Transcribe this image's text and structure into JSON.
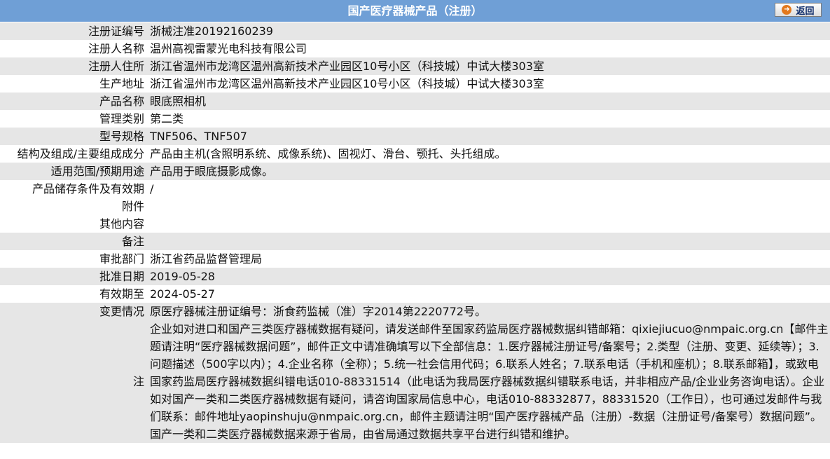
{
  "header": {
    "title": "国产医疗器械产品（注册）",
    "back_label": "返回"
  },
  "rows": [
    {
      "label": "注册证编号",
      "value": "浙械注准20192160239"
    },
    {
      "label": "注册人名称",
      "value": "温州高视雷蒙光电科技有限公司"
    },
    {
      "label": "注册人住所",
      "value": "浙江省温州市龙湾区温州高新技术产业园区10号小区（科技城）中试大楼303室"
    },
    {
      "label": "生产地址",
      "value": "浙江省温州市龙湾区温州高新技术产业园区10号小区（科技城）中试大楼303室"
    },
    {
      "label": "产品名称",
      "value": "眼底照相机"
    },
    {
      "label": "管理类别",
      "value": "第二类"
    },
    {
      "label": "型号规格",
      "value": "TNF506、TNF507"
    },
    {
      "label": "结构及组成/主要组成成分",
      "value": "产品由主机(含照明系统、成像系统)、固视灯、滑台、颚托、头托组成。"
    },
    {
      "label": "适用范围/预期用途",
      "value": "产品用于眼底摄影成像。"
    },
    {
      "label": "产品储存条件及有效期",
      "value": "/"
    },
    {
      "label": "附件",
      "value": ""
    },
    {
      "label": "其他内容",
      "value": ""
    },
    {
      "label": "备注",
      "value": ""
    },
    {
      "label": "审批部门",
      "value": "浙江省药品监督管理局"
    },
    {
      "label": "批准日期",
      "value": "2019-05-28"
    },
    {
      "label": "有效期至",
      "value": "2024-05-27"
    },
    {
      "label": "变更情况",
      "value": "原医疗器械注册证编号：浙食药监械（准）字2014第2220772号。"
    }
  ],
  "note": {
    "label": "注",
    "text": "企业如对进口和国产三类医疗器械数据有疑问，请发送邮件至国家药监局医疗器械数据纠错邮箱：qixiejiucuo@nmpaic.org.cn【邮件主题请注明“医疗器械数据问题”，邮件正文中请准确填写以下全部信息：1.医疗器械注册证号/备案号；2.类型（注册、变更、延续等）；3.问题描述（500字以内）；4.企业名称（全称）；5.统一社会信用代码；6.联系人姓名；7.联系电话（手机和座机）；8.联系邮箱】，或致电国家药监局医疗器械数据纠错电话010-88331514（此电话为我局医疗器械数据纠错联系电话，并非相应产品/企业业务咨询电话）。企业如对国产一类和二类医疗器械数据有疑问，请咨询国家局信息中心，电话010-88332877，88331520（工作日），也可通过发邮件与我们联系：邮件地址yaopinshuju@nmpaic.org.cn，邮件主题请注明“国产医疗器械产品（注册）-数据（注册证号/备案号）数据问题”。国产一类和二类医疗器械数据来源于省局，由省局通过数据共享平台进行纠错和维护。"
  },
  "colors": {
    "header_bg": "#6f9fd6",
    "row_shade": "#e6e6e6",
    "back_arrow": "#e2781c"
  }
}
